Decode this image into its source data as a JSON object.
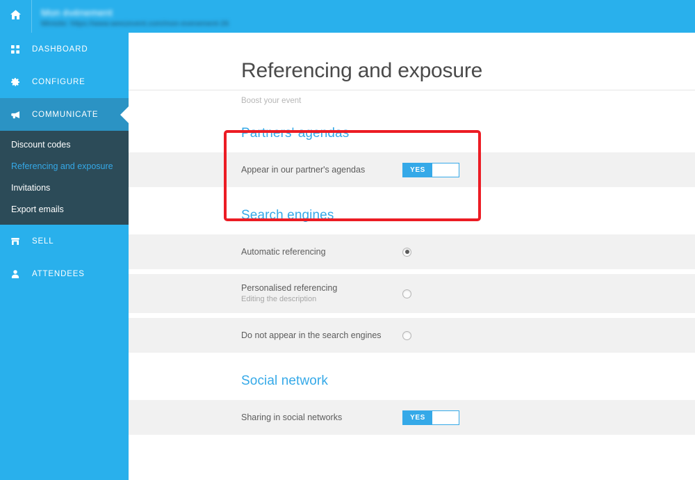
{
  "topbar": {
    "home_icon": "home-icon",
    "event_title": "Mon événement",
    "event_url": "Minisite: https://www.weezevent.com/mon-evenement-26"
  },
  "sidebar": {
    "items": [
      {
        "label": "DASHBOARD",
        "icon": "grid-icon",
        "active": false
      },
      {
        "label": "CONFIGURE",
        "icon": "gear-icon",
        "active": false
      },
      {
        "label": "COMMUNICATE",
        "icon": "megaphone-icon",
        "active": true
      },
      {
        "label": "SELL",
        "icon": "store-icon",
        "active": false
      },
      {
        "label": "ATTENDEES",
        "icon": "user-icon",
        "active": false
      }
    ],
    "submenu": [
      {
        "label": "Discount codes",
        "current": false
      },
      {
        "label": "Referencing and exposure",
        "current": true
      },
      {
        "label": "Invitations",
        "current": false
      },
      {
        "label": "Export emails",
        "current": false
      }
    ]
  },
  "page": {
    "title": "Referencing and exposure",
    "subtitle": "Boost your event"
  },
  "sections": {
    "partners": {
      "title": "Partners' agendas",
      "row_label": "Appear in our partner's agendas",
      "toggle_label": "YES",
      "toggle_value": true
    },
    "search_engines": {
      "title": "Search engines",
      "options": [
        {
          "label": "Automatic referencing",
          "sub": "",
          "selected": true
        },
        {
          "label": "Personalised referencing",
          "sub": "Editing the description",
          "selected": false
        },
        {
          "label": "Do not appear in the search engines",
          "sub": "",
          "selected": false
        }
      ]
    },
    "social": {
      "title": "Social network",
      "row_label": "Sharing in social networks",
      "toggle_label": "YES",
      "toggle_value": true
    }
  },
  "annotation": {
    "color": "#ec1c24",
    "target": "partners-agendas-section"
  },
  "colors": {
    "brand_blue": "#29b0ec",
    "accent_blue": "#35a9e8",
    "submenu_bg": "#2c4b58",
    "active_nav": "#2b93c4",
    "row_bg": "#f1f1f1",
    "annotation_red": "#ec1c24"
  }
}
